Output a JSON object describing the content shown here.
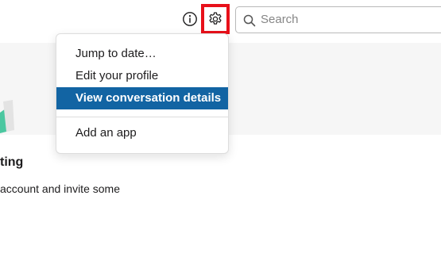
{
  "header": {
    "search": {
      "placeholder": "Search"
    },
    "icons": {
      "info": "info-circle-icon",
      "settings": "gear-icon",
      "search": "search-icon"
    },
    "settings_highlight_color": "#e8101a"
  },
  "menu": {
    "items": [
      {
        "label": "Jump to date…"
      },
      {
        "label": "Edit your profile"
      },
      {
        "label": "View conversation details",
        "active": true
      },
      {
        "label": "Add an app"
      }
    ],
    "active_color": "#1264a3"
  },
  "content": {
    "heading_fragment": "ting",
    "text_fragment": "account and invite some"
  }
}
